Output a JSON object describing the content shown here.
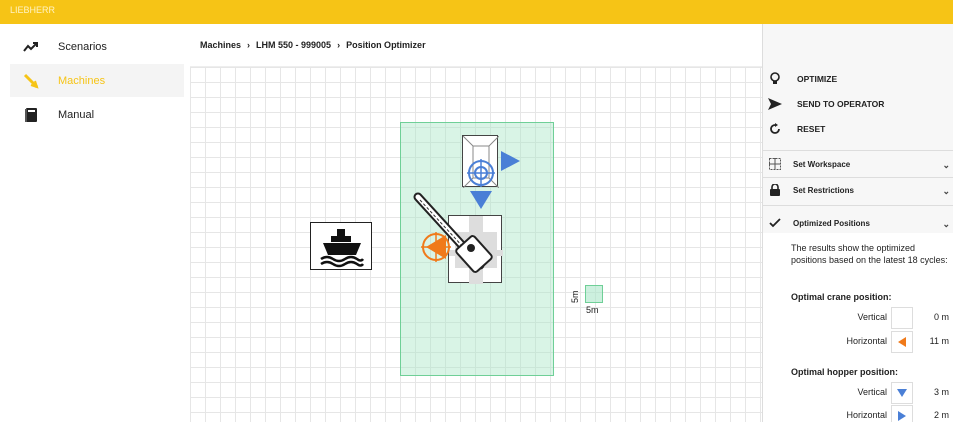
{
  "topbar": {
    "brand": "LIEBHERR",
    "color": "#f6c416"
  },
  "sidebar": {
    "items": [
      {
        "label": "Scenarios",
        "icon": "trend-icon",
        "active": false
      },
      {
        "label": "Machines",
        "icon": "crane-icon",
        "active": true
      },
      {
        "label": "Manual",
        "icon": "book-icon",
        "active": false
      }
    ]
  },
  "breadcrumb": [
    "Machines",
    "LHM 550 - 999005",
    "Position Optimizer"
  ],
  "canvas": {
    "scale": {
      "vertical": "5m",
      "horizontal": "5m"
    },
    "icons": [
      "ship-icon",
      "hopper-icon",
      "crane-icon",
      "target-icon"
    ]
  },
  "actions": [
    {
      "label": "OPTIMIZE",
      "icon": "lightbulb-icon"
    },
    {
      "label": "SEND TO OPERATOR",
      "icon": "send-icon"
    },
    {
      "label": "RESET",
      "icon": "reset-icon"
    }
  ],
  "sections": [
    {
      "label": "Set Workspace",
      "icon": "grid-icon"
    },
    {
      "label": "Set Restrictions",
      "icon": "lock-icon"
    },
    {
      "label": "Optimized Positions",
      "icon": "check-icon"
    }
  ],
  "results": {
    "description": "The results show the optimized positions based on the latest 18 cycles:",
    "crane_title": "Optimal crane position:",
    "crane": [
      {
        "label": "Vertical",
        "value": "0 m",
        "icon": "none"
      },
      {
        "label": "Horizontal",
        "value": "11 m",
        "icon": "arrow-left-orange-icon"
      }
    ],
    "hopper_title": "Optimal hopper position:",
    "hopper": [
      {
        "label": "Vertical",
        "value": "3 m",
        "icon": "arrow-down-blue-icon"
      },
      {
        "label": "Horizontal",
        "value": "2 m",
        "icon": "arrow-right-blue-icon"
      }
    ]
  },
  "colors": {
    "accent": "#f6c416",
    "workspace": "#aae6c8",
    "blue": "#4a7fd6",
    "orange": "#f07a1a"
  }
}
